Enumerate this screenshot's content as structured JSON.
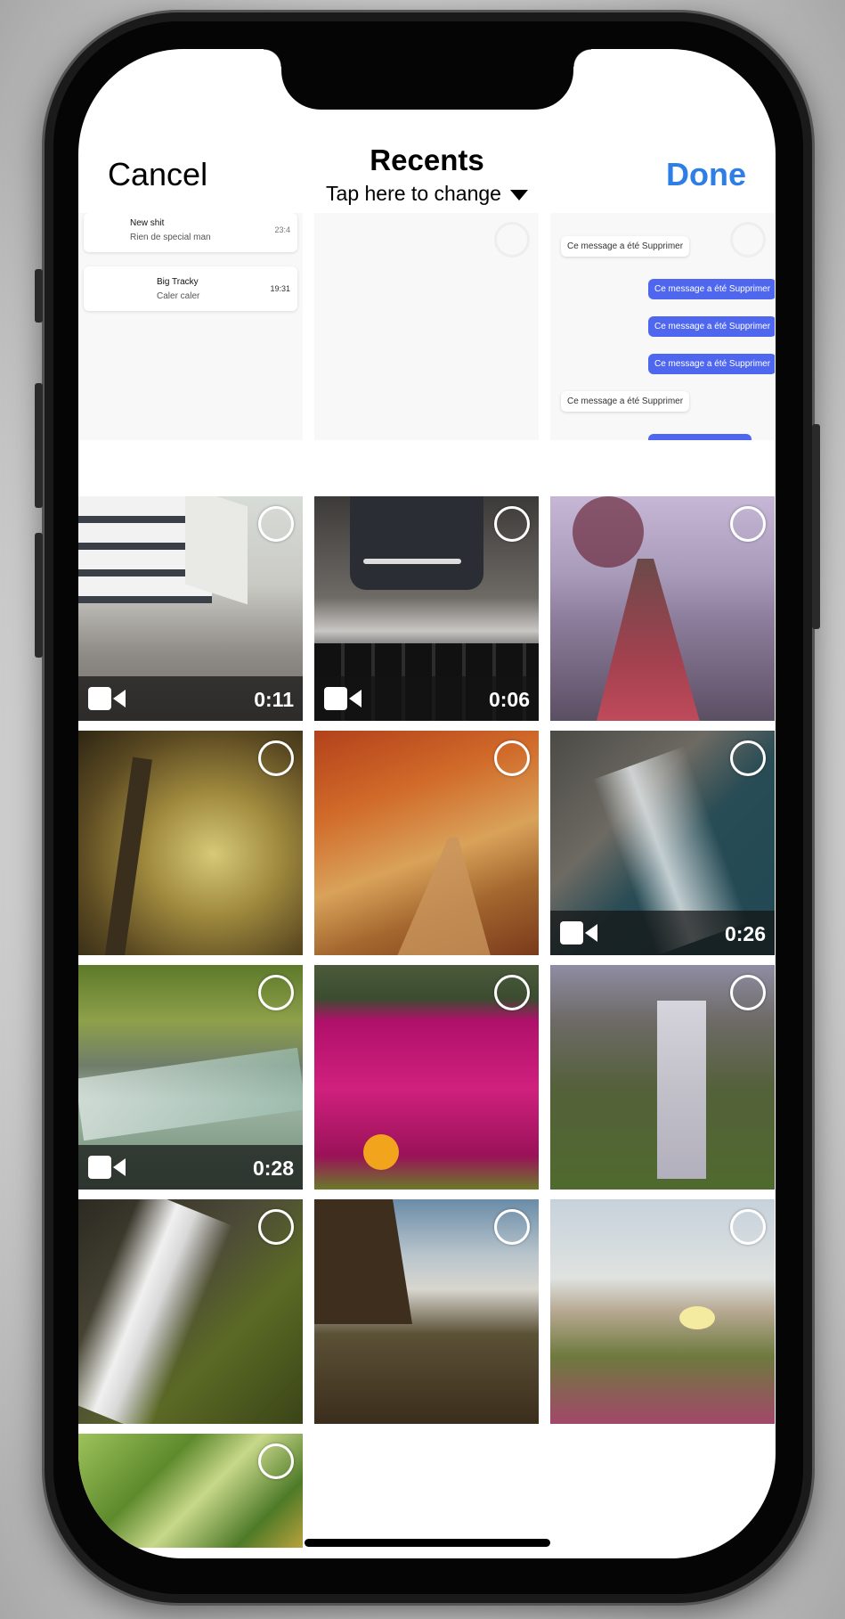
{
  "header": {
    "cancel_label": "Cancel",
    "title": "Recents",
    "subtitle": "Tap here to change",
    "done_label": "Done"
  },
  "colors": {
    "accent": "#2f7ee6",
    "bubble": "#4f67ee"
  },
  "screenshot_tiles": {
    "chat_list": [
      {
        "name": "New shit",
        "preview": "Rien de special man",
        "time": "23:4"
      },
      {
        "name": "Big Tracky",
        "preview": "Caler caler",
        "time": "19:31"
      }
    ],
    "chat_message": "Ce message a été Supprimer"
  },
  "videos": [
    {
      "duration": "0:11"
    },
    {
      "duration": "0:06"
    },
    {
      "duration": "0:26"
    },
    {
      "duration": "0:28"
    }
  ],
  "tiles": [
    {
      "subject": "chat-list-screenshot",
      "type": "photo"
    },
    {
      "subject": "blank-screenshot",
      "type": "photo"
    },
    {
      "subject": "chat-messages-screenshot",
      "type": "photo"
    },
    {
      "subject": "store-shelves",
      "type": "video",
      "video_index": 0
    },
    {
      "subject": "phone-on-laptop",
      "type": "video",
      "video_index": 1
    },
    {
      "subject": "lake-pier-red-leaves",
      "type": "photo"
    },
    {
      "subject": "forest-path",
      "type": "photo"
    },
    {
      "subject": "autumn-road",
      "type": "photo"
    },
    {
      "subject": "rocky-coast",
      "type": "video",
      "video_index": 2
    },
    {
      "subject": "forest-stream",
      "type": "video",
      "video_index": 3
    },
    {
      "subject": "pink-flowers",
      "type": "photo"
    },
    {
      "subject": "waterfall-cliff",
      "type": "photo"
    },
    {
      "subject": "waterfall-rocks",
      "type": "photo"
    },
    {
      "subject": "misty-waterfall",
      "type": "photo"
    },
    {
      "subject": "beach-flower",
      "type": "photo"
    },
    {
      "subject": "green-leaves",
      "type": "photo"
    }
  ]
}
